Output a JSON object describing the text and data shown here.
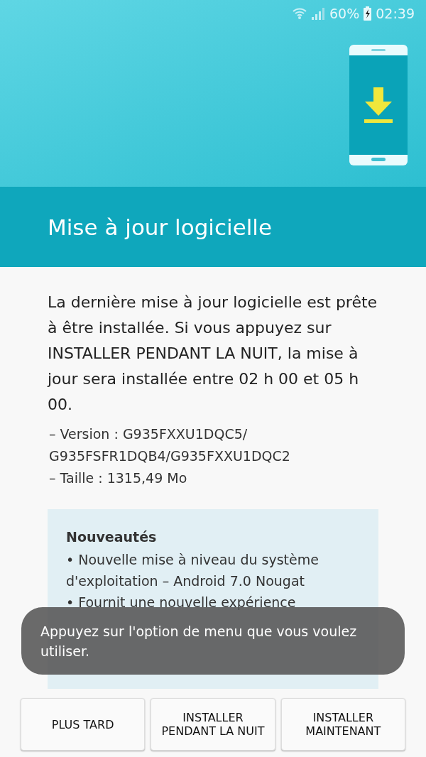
{
  "status_bar": {
    "battery": "60%",
    "time": "02:39"
  },
  "header": {
    "title": "Mise à jour logicielle"
  },
  "message": "La dernière mise à jour logicielle est prête à être installée. Si vous appuyez sur INSTALLER PENDANT LA NUIT, la mise à jour sera installée entre 02 h 00 et 05 h 00.",
  "details": [
    "– Version : G935FXXU1DQC5/ G935FSFR1DQB4/G935FXXU1DQC2",
    "– Taille : 1315,49 Mo"
  ],
  "whats_new": {
    "title": "Nouveautés",
    "items": [
      "• Nouvelle mise à niveau du système d'exploitation – Android 7.0 Nougat",
      "• Fournit une nouvelle expérience"
    ]
  },
  "toast": "Appuyez sur l'option de menu que vous voulez utiliser.",
  "buttons": [
    "PLUS TARD",
    "INSTALLER PENDANT LA NUIT",
    "INSTALLER MAINTENANT"
  ]
}
